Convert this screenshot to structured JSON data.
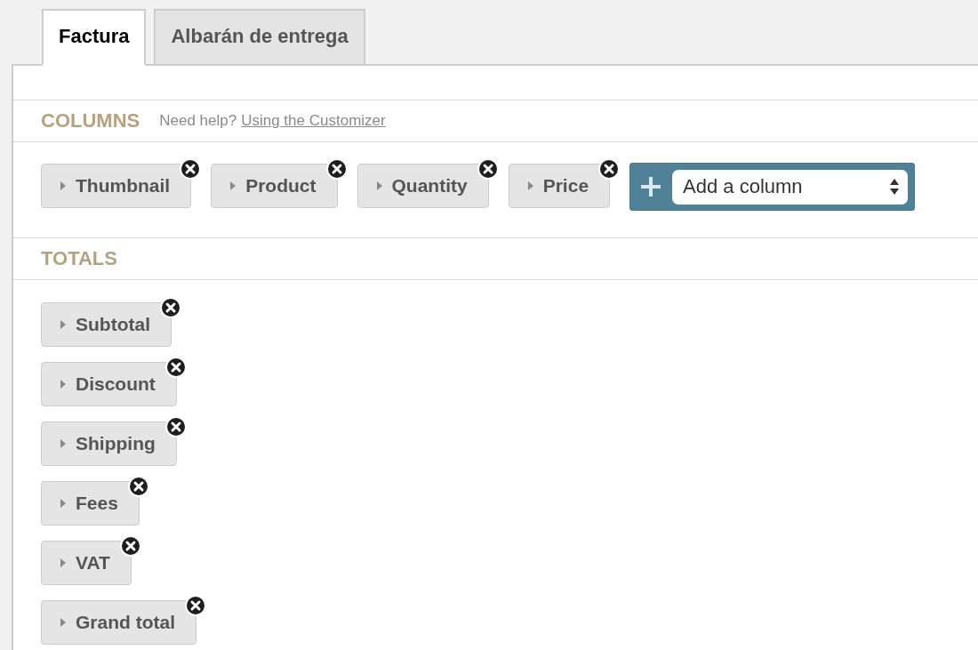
{
  "tabs": [
    {
      "label": "Factura",
      "selected": true
    },
    {
      "label": "Albarán de entrega",
      "selected": false
    }
  ],
  "columns_section": {
    "heading": "COLUMNS",
    "help_text": "Need help?",
    "help_link": "Using the Customizer",
    "items": [
      "Thumbnail",
      "Product",
      "Quantity",
      "Price"
    ],
    "add_column": {
      "select_value": "Add a column"
    }
  },
  "totals_section": {
    "heading": "TOTALS",
    "items": [
      "Subtotal",
      "Discount",
      "Shipping",
      "Fees",
      "VAT",
      "Grand total"
    ]
  }
}
